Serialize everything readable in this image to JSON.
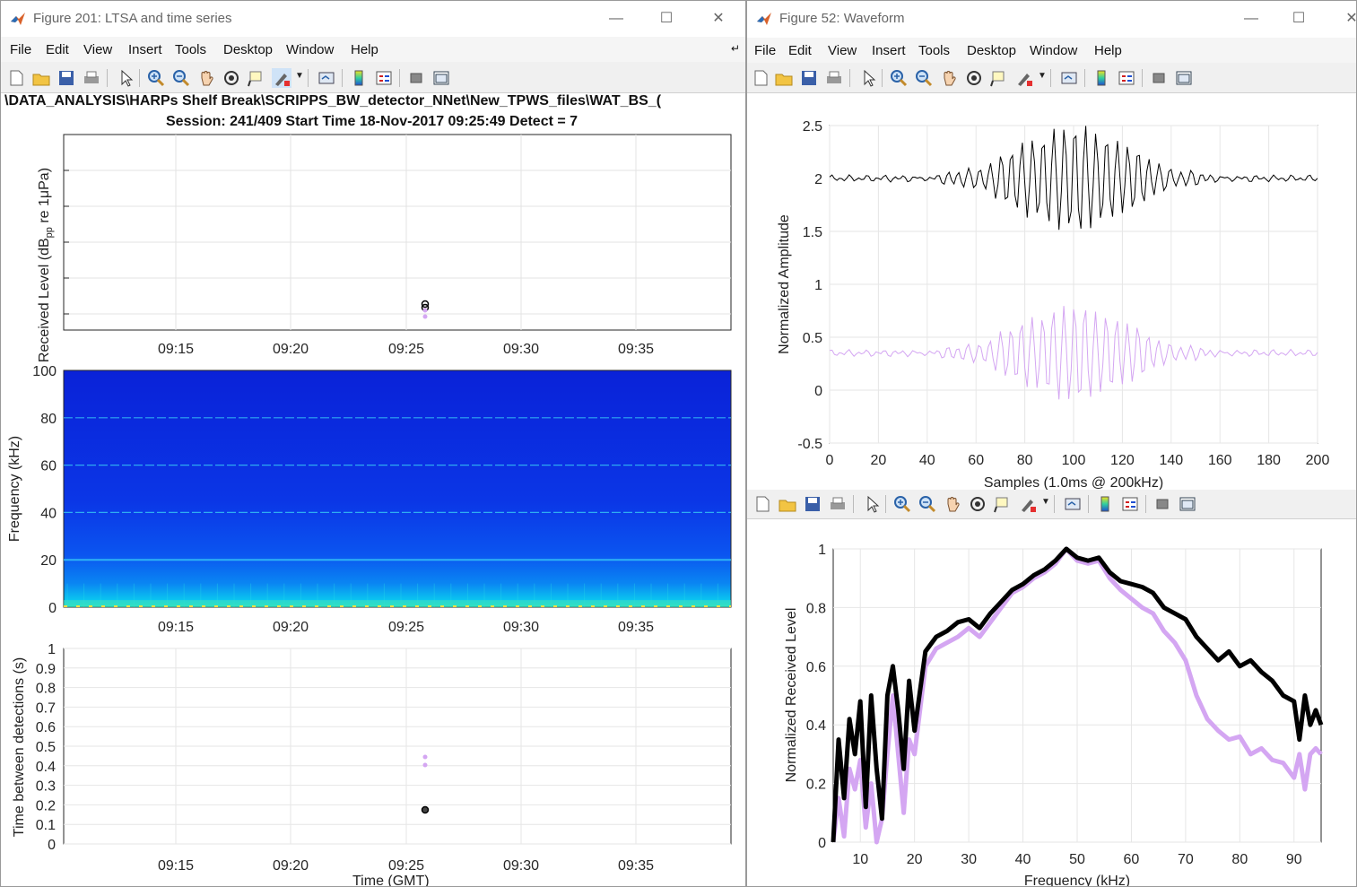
{
  "left_window": {
    "title": "Figure 201: LTSA and time series",
    "menu": [
      "File",
      "Edit",
      "View",
      "Insert",
      "Tools",
      "Desktop",
      "Window",
      "Help"
    ],
    "path_title": "\\DATA_ANALYSIS\\HARPs Shelf Break\\SCRIPPS_BW_detector_NNet\\New_TPWS_files\\WAT_BS_(",
    "session_title": "Session: 241/409 Start Time 18-Nov-2017 09:25:49 Detect = 7",
    "time_ticks": [
      "09:15",
      "09:20",
      "09:25",
      "09:30",
      "09:35"
    ],
    "rl_ylabel": "Received Level (dB",
    "rl_ylabel_sub": "pp",
    "rl_ylabel_rest": " re 1μPa)",
    "spec_ylabel": "Frequency (kHz)",
    "spec_yticks": [
      "0",
      "20",
      "40",
      "60",
      "80",
      "100"
    ],
    "ici_ylabel": "Time between detections (s)",
    "ici_yticks": [
      "0",
      "0.1",
      "0.2",
      "0.3",
      "0.4",
      "0.5",
      "0.6",
      "0.7",
      "0.8",
      "0.9",
      "1"
    ],
    "xlabel": "Time (GMT)"
  },
  "right_window": {
    "title": "Figure 52: Waveform",
    "menu": [
      "File",
      "Edit",
      "View",
      "Insert",
      "Tools",
      "Desktop",
      "Window",
      "Help"
    ]
  },
  "colors": {
    "black_series": "#000000",
    "purple_series": "#d4a6f2",
    "spec_bg": "#0a2ce0",
    "grid": "#e6e6e6"
  },
  "chart_data": [
    {
      "type": "scatter",
      "panel": "received-level",
      "ylabel": "Received Level (dBpp re 1μPa)",
      "xlabel": "",
      "x_categories": [
        "09:15",
        "09:20",
        "09:25",
        "09:30",
        "09:35"
      ],
      "points": [
        {
          "x": "09:25:49",
          "y_frac": 0.13,
          "color": "black"
        },
        {
          "x": "09:25:49",
          "y_frac": 0.07,
          "color": "purple"
        }
      ]
    },
    {
      "type": "heatmap",
      "panel": "ltsa",
      "ylabel": "Frequency (kHz)",
      "ylim": [
        0,
        100
      ],
      "tonal_bands_khz": [
        20,
        40,
        60,
        80
      ]
    },
    {
      "type": "scatter",
      "panel": "time-between-detections",
      "ylabel": "Time between detections (s)",
      "ylim": [
        0,
        1
      ],
      "xlabel": "Time (GMT)",
      "points": [
        {
          "x": "09:25:49",
          "y": 0.18,
          "color": "black"
        },
        {
          "x": "09:25:49",
          "y": 0.42,
          "color": "purple"
        },
        {
          "x": "09:25:49",
          "y": 0.44,
          "color": "purple"
        }
      ]
    },
    {
      "type": "line",
      "panel": "waveform",
      "xlabel": "Samples (1.0ms @ 200kHz)",
      "ylabel": "Normalized Amplitude",
      "xlim": [
        0,
        200
      ],
      "ylim": [
        -0.5,
        2.5
      ],
      "xticks": [
        "0",
        "20",
        "40",
        "60",
        "80",
        "100",
        "120",
        "140",
        "160",
        "180",
        "200"
      ],
      "yticks": [
        "-0.5",
        "0",
        "0.5",
        "1",
        "1.5",
        "2",
        "2.5"
      ],
      "series": [
        {
          "offset": 2.0,
          "peak_amp": 0.5,
          "center": 100,
          "color": "black"
        },
        {
          "offset": 0.35,
          "peak_amp": 0.45,
          "center": 100,
          "color": "purple"
        }
      ]
    },
    {
      "type": "line",
      "panel": "spectra",
      "xlabel": "Frequency (kHz)",
      "ylabel": "Normalized Received Level",
      "xlim": [
        5,
        95
      ],
      "ylim": [
        0,
        1
      ],
      "xticks": [
        "10",
        "20",
        "30",
        "40",
        "50",
        "60",
        "70",
        "80",
        "90"
      ],
      "yticks": [
        "0",
        "0.2",
        "0.4",
        "0.6",
        "0.8",
        "1"
      ],
      "x": [
        5,
        6,
        7,
        8,
        9,
        10,
        11,
        12,
        13,
        14,
        15,
        16,
        17,
        18,
        19,
        20,
        22,
        24,
        26,
        28,
        30,
        32,
        34,
        36,
        38,
        40,
        42,
        44,
        46,
        48,
        50,
        52,
        54,
        56,
        58,
        60,
        62,
        64,
        66,
        68,
        70,
        72,
        74,
        76,
        78,
        80,
        82,
        84,
        86,
        88,
        90,
        91,
        92,
        93,
        94,
        95
      ],
      "series": [
        {
          "name": "",
          "color": "black",
          "values": [
            0.0,
            0.35,
            0.15,
            0.42,
            0.3,
            0.48,
            0.12,
            0.5,
            0.25,
            0.08,
            0.5,
            0.6,
            0.45,
            0.25,
            0.55,
            0.38,
            0.65,
            0.7,
            0.72,
            0.75,
            0.76,
            0.73,
            0.78,
            0.82,
            0.86,
            0.88,
            0.91,
            0.93,
            0.96,
            1.0,
            0.97,
            0.96,
            0.97,
            0.92,
            0.89,
            0.88,
            0.87,
            0.85,
            0.8,
            0.78,
            0.76,
            0.7,
            0.66,
            0.62,
            0.65,
            0.6,
            0.62,
            0.58,
            0.55,
            0.5,
            0.48,
            0.35,
            0.5,
            0.4,
            0.45,
            0.4
          ]
        },
        {
          "name": "",
          "color": "purple",
          "values": [
            0.0,
            0.15,
            0.02,
            0.25,
            0.18,
            0.28,
            0.05,
            0.2,
            0.0,
            0.08,
            0.3,
            0.5,
            0.3,
            0.1,
            0.35,
            0.3,
            0.6,
            0.66,
            0.68,
            0.7,
            0.73,
            0.7,
            0.75,
            0.8,
            0.85,
            0.87,
            0.9,
            0.92,
            0.95,
            1.0,
            0.96,
            0.95,
            0.96,
            0.9,
            0.86,
            0.83,
            0.8,
            0.78,
            0.72,
            0.68,
            0.62,
            0.5,
            0.42,
            0.38,
            0.35,
            0.36,
            0.3,
            0.32,
            0.28,
            0.27,
            0.22,
            0.3,
            0.18,
            0.3,
            0.32,
            0.3
          ]
        }
      ]
    }
  ]
}
